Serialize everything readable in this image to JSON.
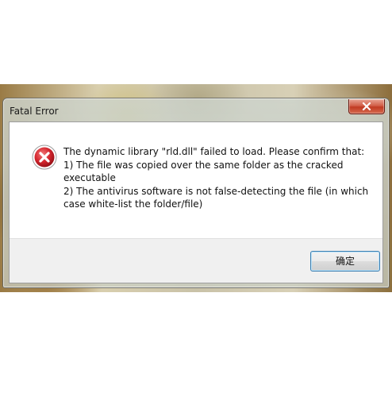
{
  "dialog": {
    "title": "Fatal Error",
    "message": "The dynamic library \"rld.dll\" failed to load. Please confirm that:\n1) The file was copied over the same folder as the cracked executable\n2) The antivirus software is not false-detecting the file (in which case white-list the folder/file)",
    "icon": "error-icon",
    "ok_label": "确定",
    "close_icon": "close-icon"
  },
  "colors": {
    "close_button": "#c13a22",
    "error_icon": "#c8202a",
    "ok_button_border": "#3c7fb1"
  }
}
